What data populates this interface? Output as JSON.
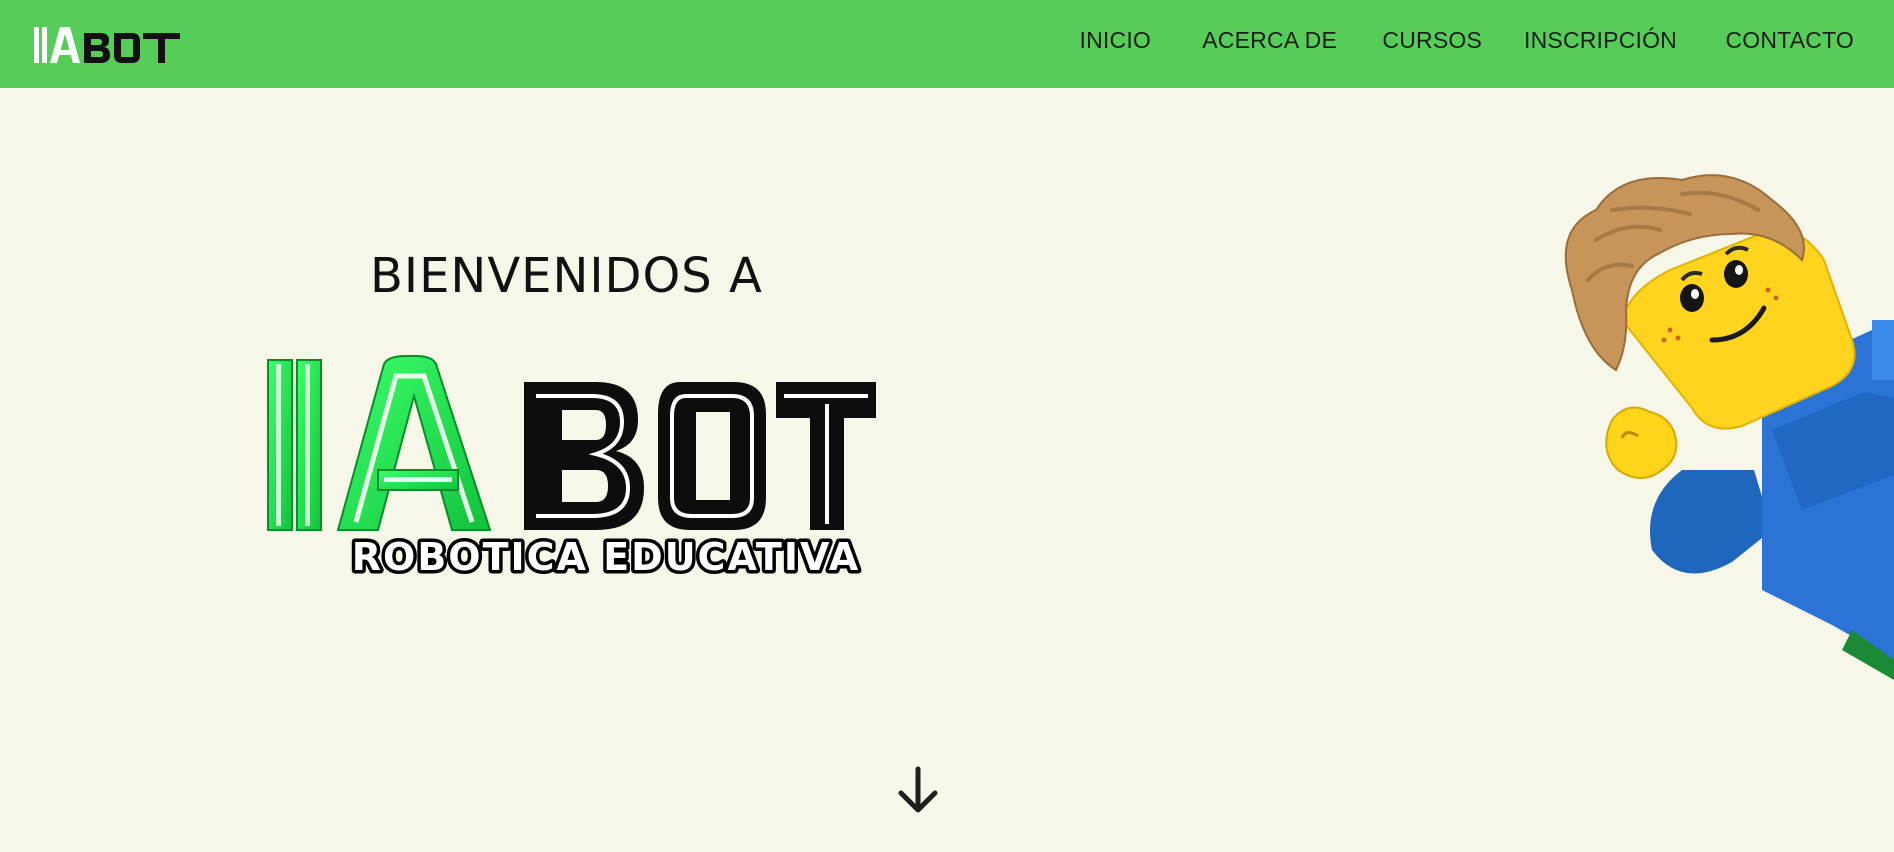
{
  "brand": {
    "logo_prefix": "IA",
    "logo_suffix": "BOT",
    "tagline": "ROBOTICA EDUCATIVA",
    "primary_color": "#56cd58",
    "logo_green": "#22e04c"
  },
  "nav": {
    "items": [
      {
        "label": "INICIO"
      },
      {
        "label": "ACERCA DE"
      },
      {
        "label": "CURSOS"
      },
      {
        "label": "INSCRIPCIÓN"
      },
      {
        "label": "CONTACTO"
      }
    ]
  },
  "hero": {
    "welcome": "BIENVENIDOS A",
    "background_color": "#f7f7e9",
    "illustration": "lego-minifigure-waving",
    "scroll_icon": "arrow-down-icon"
  }
}
